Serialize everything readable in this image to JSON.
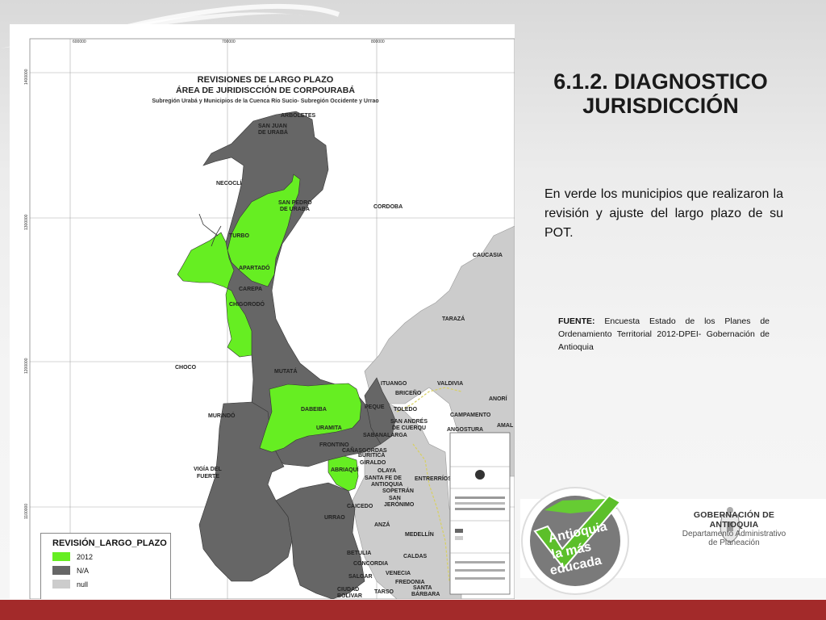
{
  "slide": {
    "title_line1": "6.1.2. DIAGNOSTICO",
    "title_line2": "JURISDICCIÓN",
    "body": "En verde los municipios que realizaron la revisión y ajuste del largo plazo de su POT.",
    "source_label": "FUENTE:",
    "source_text": " Encuesta Estado de los Planes de Ordenamiento Territorial 2012-DPEI- Gobernación de Antioquia"
  },
  "map": {
    "title1": "REVISIONES  DE LARGO PLAZO",
    "title2": "ÁREA DE JURIDISCCIÓN DE CORPOURABÁ",
    "title3": "Subregión Urabá y Municipios de la Cuenca Río Sucio- Subregión Occidente y Urrao",
    "grid_top": [
      "600000",
      "700000",
      "800000"
    ],
    "grid_left": [
      "1400000",
      "1300000",
      "1200000",
      "1100000"
    ],
    "labels": {
      "arboletes": "ARBOLETES",
      "san_juan": "SAN JUAN",
      "de_uraba": "DE URABÁ",
      "necocli": "NECOCLÍ",
      "san_pedro": "SAN PEDRO",
      "de_uraba2": "DE URABÁ",
      "cordoba": "CORDOBA",
      "turbo": "TURBO",
      "apartado": "APARTADÓ",
      "carepa": "CAREPA",
      "chigorodo": "CHIGORODÓ",
      "choco": "CHOCO",
      "mutata": "MUTATÁ",
      "dabeiba": "DABEIBA",
      "peque": "PEQUE",
      "murindo": "MURINDÓ",
      "uramita": "URAMITA",
      "frontino": "FRONTINO",
      "canasgordas": "CAÑASGORDAS",
      "abriaqui": "ABRIAQUÍ",
      "vigia1": "VIGÍA DEL",
      "vigia2": "FUERTE",
      "urrao": "URRAO",
      "caicedo": "CAICEDO",
      "betulia": "BETULIA",
      "caucasia": "CAUCASIA",
      "taraza": "TARAZÁ",
      "ituango": "ITUANGO",
      "valdivia": "VALDIVIA",
      "briceno": "BRICEÑO",
      "toledo": "TOLEDO",
      "anori": "ANORÍ",
      "campamento": "CAMPAMENTO",
      "angostura": "ANGOSTURA",
      "san_andres": "SAN ANDRÉS",
      "de_cuerqu": "DE CUERQU",
      "sabanalarga": "SABANALARGA",
      "buritica": "BURITICÁ",
      "giraldo": "GIRALDO",
      "olaya": "OLAYA",
      "santa_fe": "SANTA FE DE",
      "antioquia": "ANTIOQUIA",
      "sopetran": "SOPETRÁN",
      "san_jeronimo": "SAN",
      "jeronimo": "JERÓNIMO",
      "anza": "ANZÁ",
      "concordia": "CONCORDIA",
      "salgar": "SALGAR",
      "caldas": "CALDAS",
      "fredonia": "FREDONIA",
      "venecia": "VENECIA",
      "tarso": "TARSO",
      "ciudad": "CIUDAD",
      "bolivar": "BOLÍVAR",
      "santa_barbara": "SANTA",
      "barbara": "BÁRBARA",
      "medellin": "MEDELLÍN",
      "entrerrios": "ENTRERRÍOS",
      "sopetran2": "SOPETRÁN",
      "amalfi": "AMAL"
    }
  },
  "legend": {
    "title": "REVISIÓN_LARGO_PLAZO",
    "items": [
      {
        "label": "2012",
        "color": "#66ee22"
      },
      {
        "label": "N/A",
        "color": "#666666"
      },
      {
        "label": "null",
        "color": "#cccccc"
      }
    ]
  },
  "logos": {
    "antioquia_1": "Antioquia",
    "antioquia_2": "la más",
    "antioquia_3": "educada",
    "gob_1": "GOBERNACIÓN DE ANTIOQUIA",
    "gob_2": "Departamento Administrativo",
    "gob_3": "de Planeación"
  },
  "colors": {
    "green": "#66ee22",
    "dark": "#666666",
    "light": "#cccccc",
    "bar": "#a32a2a"
  }
}
